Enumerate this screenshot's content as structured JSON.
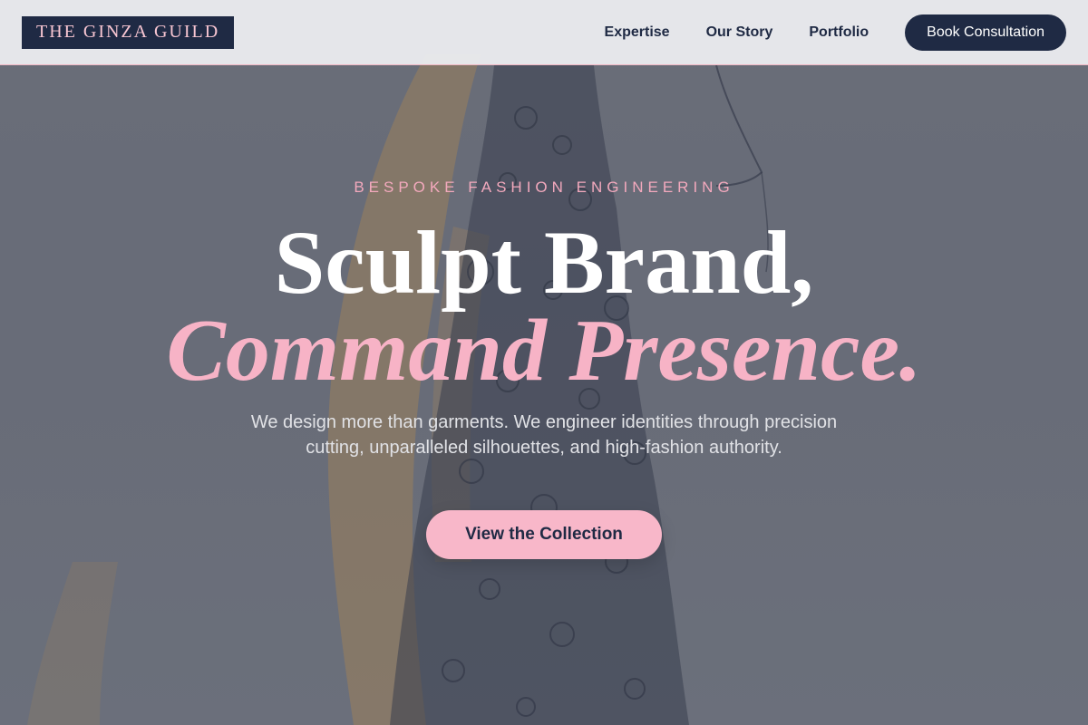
{
  "brand": {
    "logo_text": "THE GINZA GUILD"
  },
  "nav": {
    "items": [
      {
        "label": "Expertise"
      },
      {
        "label": "Our Story"
      },
      {
        "label": "Portfolio"
      }
    ],
    "cta_label": "Book Consultation"
  },
  "hero": {
    "eyebrow": "BESPOKE FASHION ENGINEERING",
    "title_line1": "Sculpt Brand,",
    "title_line2": "Command Presence.",
    "lead": "We design more than garments. We engineer identities through precision cutting, unparalleled silhouettes, and high-fashion authority.",
    "button_label": "View the Collection",
    "background_image": "fashion-sketch-illustration"
  },
  "colors": {
    "navy": "#1f2a44",
    "pink": "#f7b3c6",
    "header_bg": "#eaebee",
    "hero_overlay": "#6e717c"
  }
}
